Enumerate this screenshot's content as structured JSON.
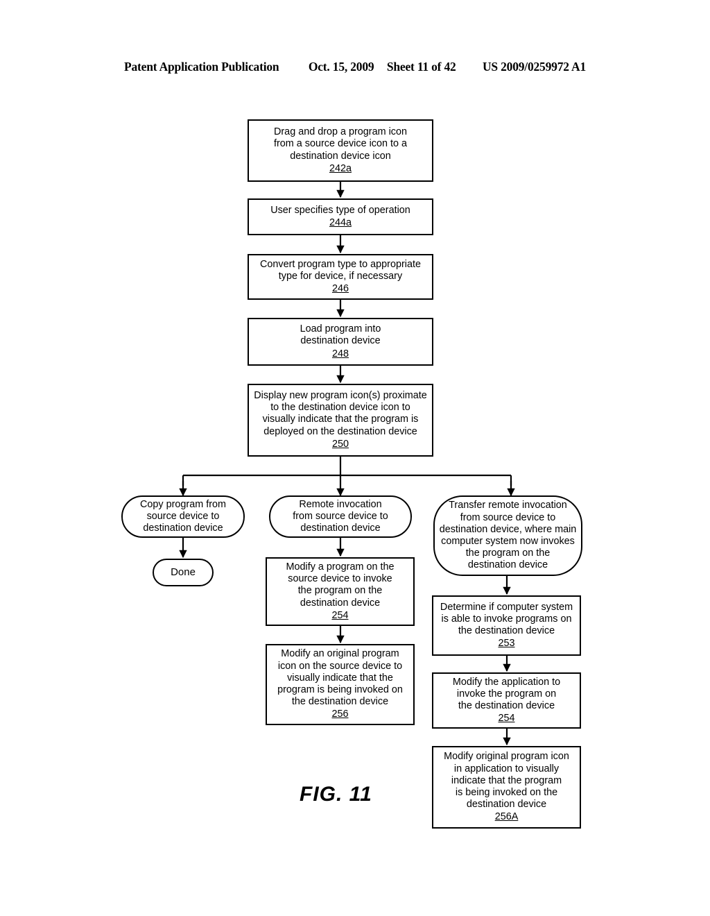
{
  "header": {
    "publication": "Patent Application Publication",
    "date": "Oct. 15, 2009",
    "sheet": "Sheet 11 of 42",
    "patent_number": "US 2009/0259972 A1"
  },
  "figure": {
    "caption": "FIG. 11"
  },
  "flowchart": {
    "nodes": {
      "n242a": {
        "text": "Drag and drop a program icon\nfrom a source device icon to a\ndestination device icon",
        "ref": "242a"
      },
      "n244a": {
        "text": "User specifies type of operation",
        "ref": "244a"
      },
      "n246": {
        "text": "Convert program type to appropriate\ntype for device, if necessary",
        "ref": "246"
      },
      "n248": {
        "text": "Load program into\ndestination device",
        "ref": "248"
      },
      "n250": {
        "text": "Display new program icon(s) proximate\nto the destination device icon to\nvisually indicate that the program is\ndeployed on the destination device",
        "ref": "250"
      },
      "branch_copy": {
        "text": "Copy program from\nsource device to\ndestination device",
        "ref": ""
      },
      "done": {
        "text": "Done",
        "ref": ""
      },
      "branch_remote": {
        "text": "Remote invocation\nfrom source device to\ndestination  device",
        "ref": ""
      },
      "n254_mid": {
        "text": "Modify a program on the\nsource device to invoke\nthe program on the\ndestination device",
        "ref": "254"
      },
      "n256": {
        "text": "Modify an original program\nicon on the source device to\nvisually indicate that the\nprogram is being invoked on\nthe destination device",
        "ref": "256"
      },
      "branch_transfer": {
        "text": "Transfer remote invocation\nfrom source device to\ndestination device, where main\ncomputer system now invokes\nthe program on the\ndestination device",
        "ref": ""
      },
      "n253": {
        "text": "Determine if computer system\nis able to invoke programs on\nthe destination device",
        "ref": "253"
      },
      "n254_right": {
        "text": "Modify the application to\ninvoke the program on\nthe destination device",
        "ref": "254"
      },
      "n256A": {
        "text": "Modify original program icon\nin application to visually\nindicate that the program\nis being invoked on the\ndestination device",
        "ref": "256A"
      }
    },
    "style": {
      "line_color": "#000000",
      "fill_color": "#ffffff"
    }
  }
}
